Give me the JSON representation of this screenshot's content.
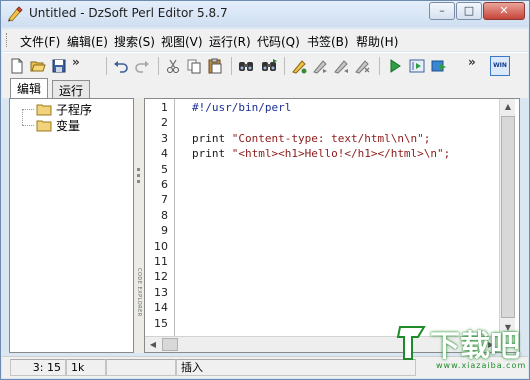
{
  "window": {
    "title": "Untitled - DzSoft Perl Editor 5.8.7",
    "controls": {
      "minimize": "–",
      "maximize": "□",
      "close": "✕"
    }
  },
  "menubar": {
    "items": [
      "文件(F)",
      "编辑(E)",
      "搜索(S)",
      "视图(V)",
      "运行(R)",
      "代码(Q)",
      "书签(B)",
      "帮助(H)"
    ]
  },
  "toolbar": {
    "icons": [
      "new-file-icon",
      "open-folder-icon",
      "save-icon",
      "undo-icon",
      "redo-icon",
      "cut-icon",
      "copy-icon",
      "paste-icon",
      "find-icon",
      "find-next-icon",
      "bookmark-toggle-icon",
      "bookmark-next-icon",
      "bookmark-prev-icon",
      "bookmark-clear-icon",
      "run-icon",
      "run-in-window-icon",
      "run-browser-icon"
    ],
    "overflow": "»",
    "win_label": "WIN"
  },
  "tabs": {
    "items": [
      "编辑",
      "运行"
    ],
    "active_index": 0
  },
  "tree": {
    "items": [
      "子程序",
      "变量"
    ]
  },
  "splitter": {
    "label": "CODE EXPLORER"
  },
  "editor": {
    "line_numbers": [
      "1",
      "2",
      "3",
      "4",
      "5",
      "6",
      "7",
      "8",
      "9",
      "10",
      "11",
      "12",
      "13",
      "14",
      "15"
    ],
    "lines": [
      {
        "parts": [
          {
            "t": "#!/usr/bin/perl",
            "c": "cmt"
          }
        ]
      },
      {
        "parts": []
      },
      {
        "parts": [
          {
            "t": "print ",
            "c": "kw"
          },
          {
            "t": "\"Content-type: text/html\\n\\n\";",
            "c": "str"
          }
        ]
      },
      {
        "parts": [
          {
            "t": "print ",
            "c": "kw"
          },
          {
            "t": "\"<html><h1>Hello!</h1></html>\\n\";",
            "c": "str"
          }
        ]
      }
    ]
  },
  "statusbar": {
    "position": "3: 15",
    "size": "1k",
    "modified": "",
    "mode": "插入"
  },
  "watermark": {
    "text": "下载吧",
    "url": "www.xiazaiba.com"
  },
  "colors": {
    "comment": "#1c2f93",
    "string": "#8c1b1b",
    "keyword": "#1a1a1a",
    "watermark_green": "#1e8b2a"
  }
}
